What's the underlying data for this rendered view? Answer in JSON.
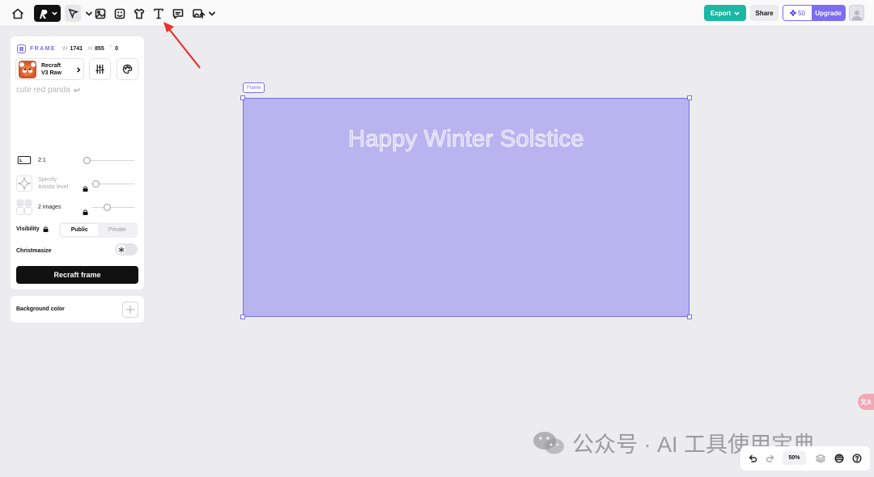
{
  "toolbar": {
    "tools": [
      "home-icon",
      "recraft-logo",
      "pointer-icon",
      "image-icon",
      "sticker-icon",
      "mockup-icon",
      "text-icon",
      "comment-icon",
      "upload-image-icon"
    ],
    "export_label": "Export",
    "share_label": "Share",
    "credits": "50",
    "upgrade_label": "Upgrade",
    "accent_color": "#7b6cf2",
    "export_color": "#1cb8a5"
  },
  "panel": {
    "frame_label": "FRAME",
    "width_key": "W",
    "width_value": "1741",
    "height_key": "H",
    "height_value": "855",
    "radius_value": "0",
    "model_name_line1": "Recraft",
    "model_name_line2": "V3 Raw",
    "prompt": "cute red panda",
    "aspect_ratio": "2:1",
    "artistic_level_line1": "Specify",
    "artistic_level_line2": "Artistic level",
    "images_count": "2 images",
    "visibility_label": "Visibility",
    "visibility_options": [
      "Public",
      "Private"
    ],
    "visibility_selected": "Public",
    "christmasize_label": "Christmasize",
    "recraft_button": "Recraft frame"
  },
  "panel2": {
    "background_label": "Background color"
  },
  "canvas": {
    "frame_tag": "Frame",
    "frame_text": "Happy Winter Solstice",
    "frame_color": "#b7b4f0"
  },
  "bottom_bar": {
    "zoom": "50%"
  },
  "watermark": {
    "text": "公众号 · AI 工具使用宝典"
  },
  "translate_badge": "文A"
}
